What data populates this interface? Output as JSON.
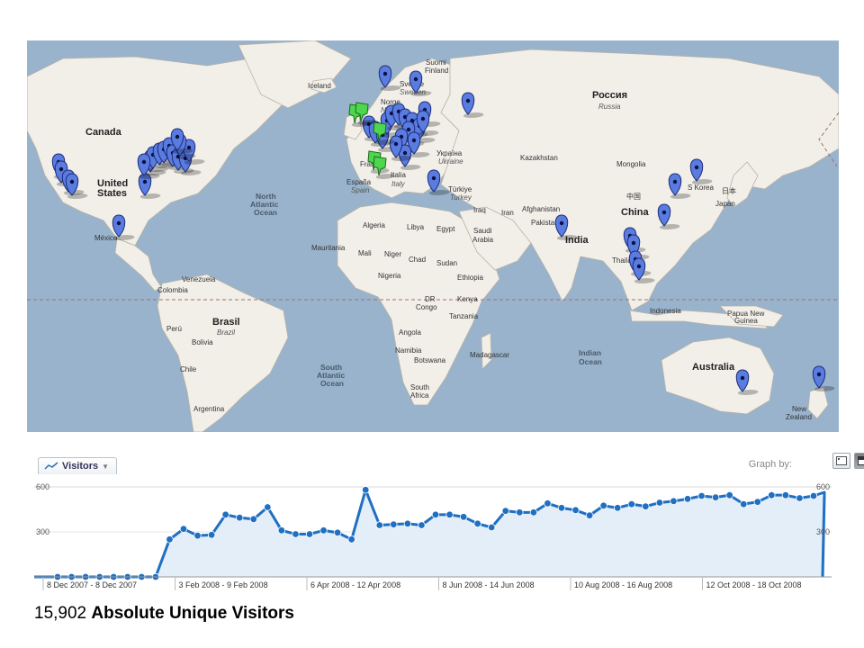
{
  "map": {
    "labels": {
      "canada": "Canada",
      "united_states_1": "United",
      "united_states_2": "States",
      "mexico": "México",
      "venezuela": "Venezuela",
      "colombia": "Colombia",
      "peru": "Perú",
      "bolivia": "Bolivia",
      "chile": "Chile",
      "argentina": "Argentina",
      "brasil": "Brasil",
      "brasil_sub": "Brazil",
      "iceland": "Iceland",
      "norway": "Norge",
      "norway_sub": "Norway",
      "sweden": "Sverige",
      "sweden_sub": "Sweden",
      "finland_1": "Suomi",
      "finland_2": "Finland",
      "russia": "Россия",
      "russia_sub": "Russia",
      "ukraine": "Україна",
      "ukraine_sub": "Ukraine",
      "kazakhstan": "Kazakhstan",
      "mongolia": "Mongolia",
      "china_cn": "中国",
      "china": "China",
      "south_korea": "S Korea",
      "japan_jp": "日本",
      "japan": "Japan",
      "turkey": "Türkiye",
      "turkey_sub": "Turkey",
      "iraq": "Iraq",
      "iran": "Iran",
      "afghanistan": "Afghanistan",
      "pakistan": "Pakistan",
      "india": "India",
      "thailand": "Thailand",
      "indonesia": "Indonesia",
      "png_1": "Papua New",
      "png_2": "Guinea",
      "australia": "Australia",
      "new_zealand_1": "New",
      "new_zealand_2": "Zealand",
      "spain": "España",
      "spain_sub": "Spain",
      "italy": "Italia",
      "italy_sub": "Italy",
      "france": "France",
      "algeria": "Algeria",
      "libya": "Libya",
      "egypt": "Egypt",
      "saudi_1": "Saudi",
      "saudi_2": "Arabia",
      "mauritania": "Mauritania",
      "mali": "Mali",
      "niger": "Niger",
      "chad": "Chad",
      "sudan": "Sudan",
      "nigeria": "Nigeria",
      "ethiopia": "Ethiopia",
      "dr_1": "DR",
      "dr_2": "Congo",
      "kenya": "Kenya",
      "tanzania": "Tanzania",
      "angola": "Angola",
      "namibia": "Namibia",
      "botswana": "Botswana",
      "madagascar": "Madagascar",
      "south_africa_1": "South",
      "south_africa_2": "Africa",
      "n_atlantic_1": "North",
      "n_atlantic_2": "Atlantic",
      "n_atlantic_3": "Ocean",
      "s_atlantic_1": "South",
      "s_atlantic_2": "Atlantic",
      "s_atlantic_3": "Ocean",
      "indian_1": "Indian",
      "indian_2": "Ocean"
    },
    "colors": {
      "water": "#99b3cc",
      "land": "#f2efe9",
      "blue_marker": "#5a7be0",
      "green_marker": "#4fd64f"
    }
  },
  "graph_header": {
    "series_label": "Visitors",
    "series_icon": "trend-line-icon",
    "graph_by_label": "Graph by:"
  },
  "chart_data": {
    "type": "area",
    "title": "",
    "ylim": [
      0,
      600
    ],
    "y_ticks_left": [
      "600",
      "300"
    ],
    "y_ticks_right": [
      "600",
      "300"
    ],
    "x_labels": [
      "8 Dec 2007 - 8 Dec 2007",
      "3 Feb 2008 - 9 Feb 2008",
      "6 Apr 2008 - 12 Apr 2008",
      "8 Jun 2008 - 14 Jun 2008",
      "10 Aug 2008 - 16 Aug 2008",
      "12 Oct 2008 - 18 Oct 2008"
    ],
    "series": [
      {
        "name": "Visitors",
        "color": "#1f6fc2",
        "fill": "#e3eef8",
        "values": [
          0,
          0,
          0,
          0,
          0,
          0,
          0,
          0,
          250,
          320,
          275,
          280,
          415,
          395,
          385,
          465,
          310,
          285,
          285,
          310,
          295,
          250,
          580,
          345,
          350,
          355,
          345,
          415,
          415,
          400,
          355,
          330,
          440,
          430,
          430,
          490,
          460,
          445,
          410,
          475,
          460,
          485,
          470,
          495,
          505,
          520,
          540,
          530,
          545,
          485,
          500,
          545,
          545,
          525,
          540
        ]
      }
    ]
  },
  "summary": {
    "count": "15,902",
    "label": "Absolute Unique Visitors"
  }
}
